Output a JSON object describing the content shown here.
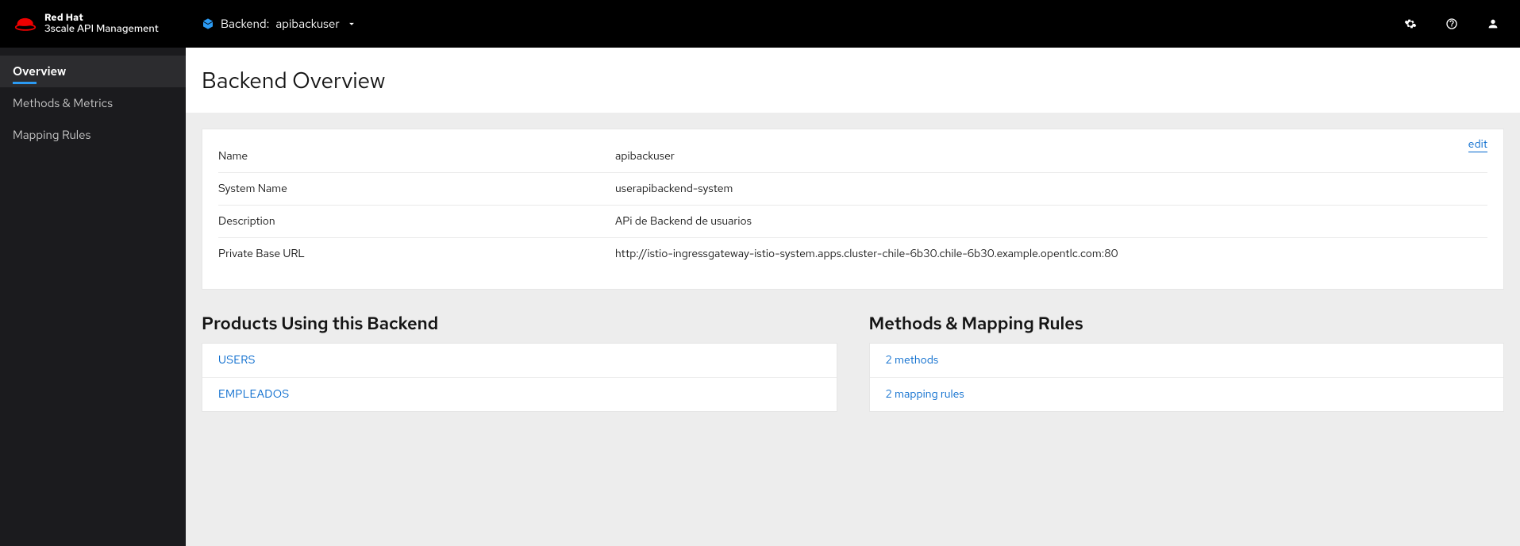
{
  "brand": {
    "top": "Red Hat",
    "bottom": "3scale API Management"
  },
  "context": {
    "prefix": "Backend:",
    "name": "apibackuser"
  },
  "sidebar": {
    "items": [
      {
        "label": "Overview",
        "active": true
      },
      {
        "label": "Methods & Metrics",
        "active": false
      },
      {
        "label": "Mapping Rules",
        "active": false
      }
    ]
  },
  "page": {
    "title": "Backend Overview",
    "edit_label": "edit"
  },
  "details": [
    {
      "label": "Name",
      "value": "apibackuser"
    },
    {
      "label": "System Name",
      "value": "userapibackend-system"
    },
    {
      "label": "Description",
      "value": "APi de Backend de usuarios"
    },
    {
      "label": "Private Base URL",
      "value": "http://istio-ingressgateway-istio-system.apps.cluster-chile-6b30.chile-6b30.example.opentlc.com:80"
    }
  ],
  "products_section": {
    "title": "Products Using this Backend",
    "items": [
      {
        "label": "USERS"
      },
      {
        "label": "EMPLEADOS"
      }
    ]
  },
  "methods_section": {
    "title": "Methods & Mapping Rules",
    "items": [
      {
        "label": "2 methods"
      },
      {
        "label": "2 mapping rules"
      }
    ]
  }
}
